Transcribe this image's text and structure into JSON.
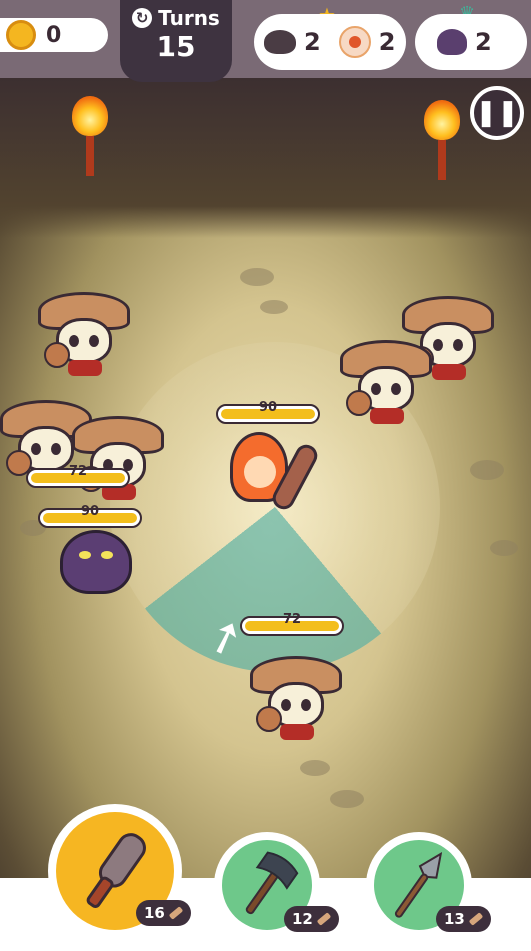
{
  "hud": {
    "coins": "0",
    "turns_label": "Turns",
    "turns_value": "15",
    "goals": [
      {
        "icon": "spider-icon",
        "count": "2"
      },
      {
        "icon": "eyeball-icon",
        "count": "2"
      }
    ],
    "boss_goal": {
      "icon": "snake-icon",
      "count": "2"
    }
  },
  "board": {
    "hero_hp": "90",
    "enemy_hp": [
      {
        "name": "skeleton-left",
        "hp": "72"
      },
      {
        "name": "snake",
        "hp": "90"
      },
      {
        "name": "skeleton-bottom",
        "hp": "72"
      }
    ]
  },
  "weapons": [
    {
      "name": "club",
      "count": "16",
      "selected": true
    },
    {
      "name": "battle-axe",
      "count": "12",
      "selected": false
    },
    {
      "name": "spear",
      "count": "13",
      "selected": false
    }
  ]
}
